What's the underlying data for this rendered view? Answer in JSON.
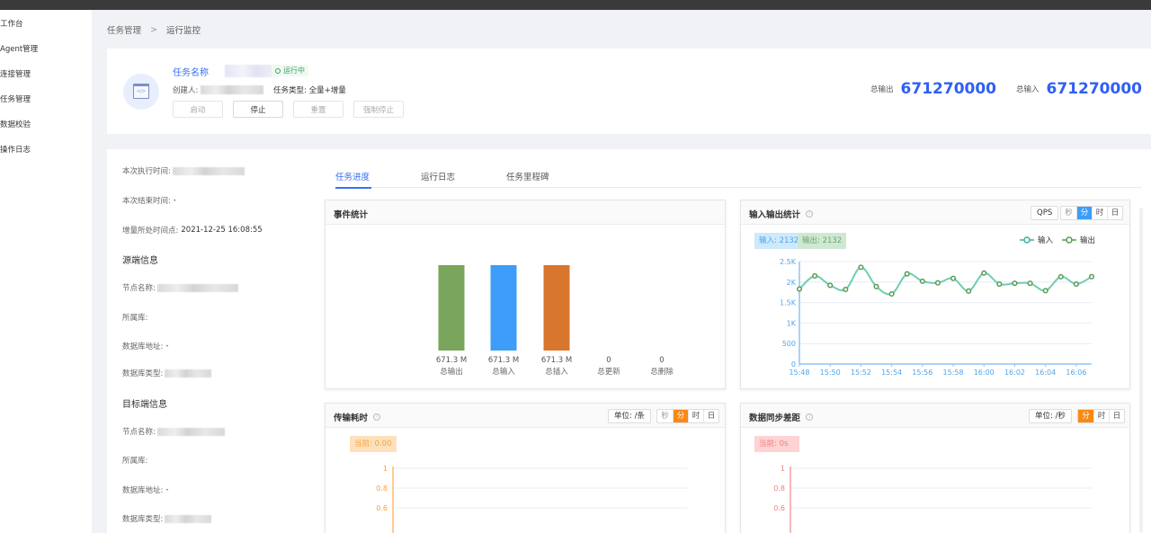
{
  "sidebar": {
    "items": [
      {
        "label": "工作台"
      },
      {
        "label": "Agent管理"
      },
      {
        "label": "连接管理"
      },
      {
        "label": "任务管理"
      },
      {
        "label": "数据校验"
      },
      {
        "label": "操作日志"
      }
    ]
  },
  "breadcrumb": {
    "parent": "任务管理",
    "separator": ">",
    "current": "运行监控"
  },
  "task": {
    "name_label": "任务名称",
    "status": "运行中",
    "creator_label": "创建人:",
    "type_label": "任务类型: 全量+增量",
    "icon": "code-window-icon",
    "actions": [
      {
        "label": "启动",
        "enabled": false
      },
      {
        "label": "停止",
        "enabled": true
      },
      {
        "label": "重置",
        "enabled": false
      },
      {
        "label": "强制停止",
        "enabled": false
      }
    ],
    "totals": {
      "output_label": "总输出",
      "output_value": "671270000",
      "input_label": "总输入",
      "input_value": "671270000"
    }
  },
  "info": {
    "exec_time_label": "本次执行时间:",
    "end_time_label": "本次结束时间:",
    "end_time_value": "-",
    "increment_label": "增量所处时间点:",
    "increment_value": "2021-12-25 16:08:55",
    "source": {
      "title": "源端信息",
      "node_label": "节点名称:",
      "db_label": "所属库:",
      "addr_label": "数据库地址:",
      "addr_value": "-",
      "type_label": "数据库类型:"
    },
    "target": {
      "title": "目标端信息",
      "node_label": "节点名称:",
      "db_label": "所属库:",
      "addr_label": "数据库地址:",
      "addr_value": "-",
      "type_label": "数据库类型:"
    }
  },
  "tabs": [
    {
      "label": "任务进度",
      "active": true
    },
    {
      "label": "运行日志",
      "active": false
    },
    {
      "label": "任务里程碑",
      "active": false
    }
  ],
  "colors": {
    "accent": "#3a6ff7",
    "bar_output": "#7aa55c",
    "bar_input": "#3d9df8",
    "bar_insert": "#d9762e",
    "line": "#6fcfb0",
    "line_point": "#5a9a55",
    "orange": "#f98a12",
    "red_axis": "#f4a0a0"
  },
  "event_stats": {
    "title": "事件统计"
  },
  "io_stats": {
    "title": "输入输出统计",
    "qps_label": "QPS",
    "granularity": [
      "秒",
      "分",
      "时",
      "日"
    ],
    "granularity_active": "分",
    "input_chip": "输入: 2132",
    "output_chip": "输出: 2132",
    "legend": [
      "输入",
      "输出"
    ]
  },
  "latency": {
    "title": "传输耗时",
    "unit_label": "单位: /条",
    "granularity": [
      "秒",
      "分",
      "时",
      "日"
    ],
    "granularity_active": "分",
    "current_chip": "当前: 0.00"
  },
  "sync_gap": {
    "title": "数据同步差距",
    "unit_label": "单位: /秒",
    "granularity": [
      "分",
      "时",
      "日"
    ],
    "granularity_active": "分",
    "current_chip": "当前: 0s"
  },
  "chart_data": [
    {
      "id": "event-stats",
      "type": "bar",
      "title": "事件统计",
      "categories": [
        "总输出",
        "总输入",
        "总插入",
        "总更新",
        "总删除"
      ],
      "values": [
        671.3,
        671.3,
        671.3,
        0,
        0
      ],
      "value_labels": [
        "671.3 M",
        "671.3 M",
        "671.3 M",
        "0",
        "0"
      ],
      "unit": "M",
      "colors": [
        "#7aa55c",
        "#3d9df8",
        "#d9762e",
        "#cccccc",
        "#cccccc"
      ]
    },
    {
      "id": "io-stats",
      "type": "line",
      "title": "输入输出统计",
      "x": [
        "15:48",
        "15:49",
        "15:50",
        "15:51",
        "15:52",
        "15:53",
        "15:54",
        "15:55",
        "15:56",
        "15:57",
        "15:58",
        "15:59",
        "16:00",
        "16:01",
        "16:02",
        "16:03",
        "16:04",
        "16:05",
        "16:06",
        "16:07"
      ],
      "x_tick_labels": [
        "15:48",
        "15:50",
        "15:52",
        "15:54",
        "15:56",
        "15:58",
        "16:00",
        "16:02",
        "16:04",
        "16:06"
      ],
      "series": [
        {
          "name": "输入",
          "values": [
            1830,
            2150,
            1920,
            1820,
            2360,
            1890,
            1710,
            2200,
            2020,
            1980,
            2090,
            1780,
            2220,
            1950,
            1970,
            1970,
            1790,
            2130,
            1950,
            2132
          ]
        },
        {
          "name": "输出",
          "values": [
            1830,
            2150,
            1920,
            1820,
            2360,
            1890,
            1710,
            2200,
            2020,
            1980,
            2090,
            1780,
            2220,
            1950,
            1970,
            1970,
            1790,
            2130,
            1950,
            2132
          ]
        }
      ],
      "ylim": [
        0,
        2500
      ],
      "y_ticks": [
        0,
        500,
        1000,
        1500,
        2000,
        2500
      ],
      "y_tick_labels": [
        "0",
        "500",
        "1K",
        "1.5K",
        "2K",
        "2.5K"
      ],
      "grid": true,
      "legend": "top-right"
    },
    {
      "id": "latency",
      "type": "line",
      "title": "传输耗时",
      "series": [],
      "y_ticks": [
        0.6,
        0.8,
        1
      ],
      "y_tick_labels": [
        "0.6",
        "0.8",
        "1"
      ],
      "ylim": [
        0,
        1
      ],
      "grid": true
    },
    {
      "id": "sync-gap",
      "type": "line",
      "title": "数据同步差距",
      "series": [],
      "y_ticks": [
        0.6,
        0.8,
        1
      ],
      "y_tick_labels": [
        "0.6",
        "0.8",
        "1"
      ],
      "ylim": [
        0,
        1
      ],
      "grid": true
    }
  ]
}
